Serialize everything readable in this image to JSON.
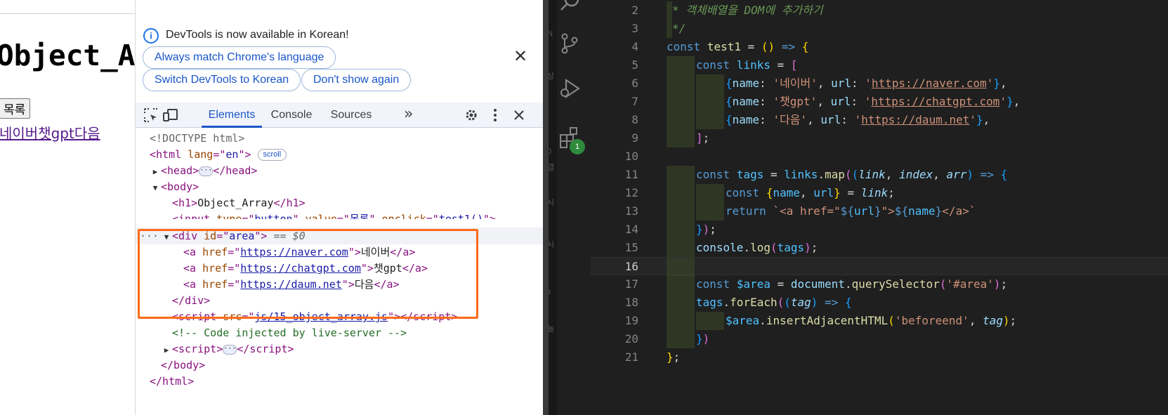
{
  "page": {
    "heading": "Object_Array",
    "button_label": "목록",
    "links": [
      "네이버",
      "챗gpt",
      "다음"
    ]
  },
  "devtools": {
    "notice_text": "DevTools is now available in Korean!",
    "notice_buttons": [
      "Always match Chrome's language",
      "Switch DevTools to Korean",
      "Don't show again"
    ],
    "tabs": [
      "Elements",
      "Console",
      "Sources"
    ],
    "active_tab": "Elements",
    "scroll_badge": "scroll",
    "eq_sign": "==",
    "sel_var": "$0",
    "tree": {
      "doctype": "<!DOCTYPE html>",
      "html_tag": "html",
      "lang_attr": "lang",
      "lang_val": "en",
      "head_tag": "head",
      "body_tag": "body",
      "h1_tag": "h1",
      "h1_text": "Object_Array",
      "input_tag": "input",
      "type_attr": "type",
      "type_val": "button",
      "value_attr": "value",
      "value_val": "목록",
      "onclick_attr": "onclick",
      "onclick_val": "test1()",
      "div_tag": "div",
      "id_attr": "id",
      "id_val": "area",
      "a_tag": "a",
      "href_attr": "href",
      "links": [
        {
          "href": "https://naver.com",
          "text": "네이버"
        },
        {
          "href": "https://chatgpt.com",
          "text": "챗gpt"
        },
        {
          "href": "https://daum.net",
          "text": "다음"
        }
      ],
      "script_tag": "script",
      "src_attr": "src",
      "src_val": "js/15_object_array.js",
      "comment": "<!-- Code injected by live-server -->",
      "close_body": "</body>",
      "close_html": "</html>"
    },
    "colors": {
      "accent": "#1a56c8",
      "highlight": "#ff6a1a"
    }
  },
  "vscode": {
    "badge_count": "1",
    "line_numbers": [
      "2",
      "3",
      "4",
      "5",
      "6",
      "7",
      "8",
      "9",
      "10",
      "11",
      "12",
      "13",
      "14",
      "15",
      "16",
      "17",
      "18",
      "19",
      "20",
      "21"
    ],
    "current_line": "16",
    "code": {
      "c2": "* 객체배열을 DOM에 추가하기",
      "c3": "*/",
      "const": "const",
      "return": "return",
      "test1": "test1",
      "links": "links",
      "tags": "tags",
      "map": "map",
      "link": "link",
      "index": "index",
      "arr": "arr",
      "name": "name",
      "url": "url",
      "k_name": "name",
      "k_url": "url",
      "s_naver": "'네이버'",
      "u_naver": "https://naver.com",
      "s_gpt": "'챗gpt'",
      "u_gpt": "https://chatgpt.com",
      "s_daum": "'다음'",
      "u_daum": "https://daum.net",
      "tpl_a": "<a href=\"",
      "tpl_b": "\">",
      "tpl_c": "</a>",
      "console": "console",
      "log": "log",
      "area": "$area",
      "document": "document",
      "qs": "querySelector",
      "sel": "'#area'",
      "forEach": "forEach",
      "tag": "tag",
      "iah": "insertAdjacentHTML",
      "beforeend": "'beforeend'"
    }
  }
}
